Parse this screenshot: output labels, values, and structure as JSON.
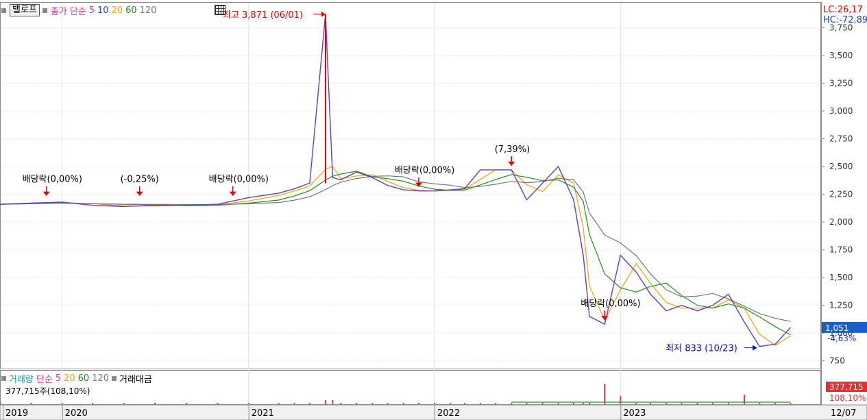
{
  "legend": {
    "stock_name": "밸로프",
    "price_type": "종가",
    "ma_type": "단순",
    "ma_periods": [
      "5",
      "10",
      "20",
      "60",
      "120"
    ],
    "ma_colors": [
      "#e0309a",
      "#2244cc",
      "#f0a000",
      "#209020",
      "#777777"
    ]
  },
  "volume_legend": {
    "title": "거래량",
    "ma_type": "단순",
    "ma_periods": [
      "5",
      "20",
      "60",
      "120"
    ],
    "ma_colors": [
      "#e0309a",
      "#f0a000",
      "#209020",
      "#777777"
    ],
    "amount_label": "거래대금",
    "current_volume": "377,715주(108,10%)"
  },
  "right_panel": {
    "lc_label": "LC:26,17",
    "hc_label": "HC:-72,89",
    "current_price": "1,051",
    "change_pct": "-4,63%",
    "volume_badge": "377,715",
    "volume_pct": "108,10%",
    "date_label": "12/07"
  },
  "annotations": {
    "high_label": "최고 3,871 (06/01)",
    "low_label": "최저 833 (10/23)",
    "dividend_labels": [
      {
        "text": "배당락(0,00%)",
        "date": "2019-12"
      },
      {
        "text": "(-0,25%)",
        "date": "2020-06"
      },
      {
        "text": "배당락(0,00%)",
        "date": "2020-12"
      },
      {
        "text": "배당락(0,00%)",
        "date": "2021-12"
      },
      {
        "text": "(7,39%)",
        "date": "2022-06"
      },
      {
        "text": "배당락(0,00%)",
        "date": "2022-12"
      }
    ]
  },
  "chart_data": {
    "type": "line",
    "title": "",
    "price_axis": {
      "ticks": [
        3750,
        3500,
        3250,
        3000,
        2750,
        2500,
        2250,
        2000,
        1750,
        1500,
        1250,
        1000,
        750
      ],
      "tick_labels": [
        "3,750",
        "3,500",
        "3,250",
        "3,000",
        "2,750",
        "2,500",
        "2,250",
        "2,000",
        "1,750",
        "1,500",
        "1,250",
        "1,000",
        "750"
      ],
      "ylim": [
        680,
        3950
      ]
    },
    "x_axis": {
      "labels": [
        "2019",
        "2020",
        "2021",
        "2022",
        "2023"
      ],
      "xlim": [
        "2019-09",
        "2023-12"
      ]
    },
    "series": [
      {
        "name": "종가",
        "x": [
          "2019-09",
          "2019-11",
          "2020-01",
          "2020-03",
          "2020-05",
          "2020-07",
          "2020-09",
          "2020-11",
          "2021-01",
          "2021-03",
          "2021-04",
          "2021-05",
          "2021-06",
          "2021-06-15",
          "2021-07",
          "2021-08",
          "2021-09",
          "2021-10",
          "2021-11",
          "2021-12",
          "2022-01",
          "2022-02",
          "2022-03",
          "2022-04",
          "2022-05",
          "2022-06",
          "2022-07",
          "2022-08",
          "2022-09",
          "2022-10",
          "2022-10-20",
          "2022-11",
          "2022-12",
          "2023-01",
          "2023-02",
          "2023-03",
          "2023-04",
          "2023-05",
          "2023-06",
          "2023-07",
          "2023-08",
          "2023-09",
          "2023-10",
          "2023-11",
          "2023-12"
        ],
        "values": [
          2160,
          2170,
          2180,
          2150,
          2140,
          2150,
          2150,
          2160,
          2220,
          2260,
          2300,
          2350,
          3871,
          2400,
          2380,
          2450,
          2400,
          2330,
          2290,
          2280,
          2280,
          2290,
          2300,
          2470,
          2470,
          2470,
          2200,
          2350,
          2500,
          2200,
          1700,
          1150,
          1080,
          1700,
          1550,
          1350,
          1200,
          1250,
          1200,
          1250,
          1350,
          1100,
          880,
          900,
          1051
        ]
      }
    ],
    "volume": {
      "current": 377715,
      "peak_date": "2022-12"
    },
    "grid": true,
    "legend_position": "top-left"
  }
}
